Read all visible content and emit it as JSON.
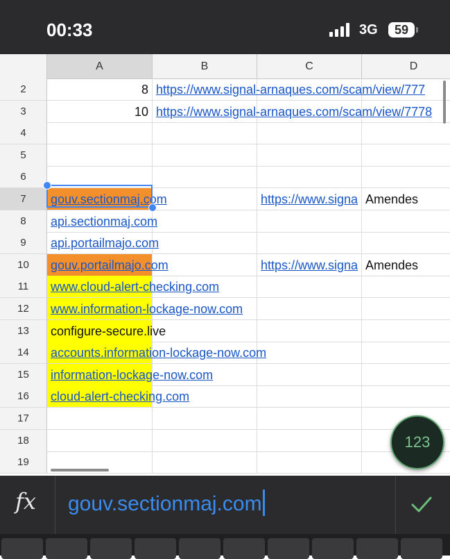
{
  "status": {
    "time": "00:33",
    "network": "3G",
    "battery": "59"
  },
  "columns": [
    "A",
    "B",
    "C",
    "D"
  ],
  "rows": [
    {
      "num": "2",
      "a": "8",
      "b": "https://www.signal-arnaques.com/scam/view/777",
      "c": "",
      "d": ""
    },
    {
      "num": "3",
      "a": "10",
      "b": "https://www.signal-arnaques.com/scam/view/7778",
      "c": "",
      "d": ""
    },
    {
      "num": "4",
      "a": "",
      "b": "",
      "c": "",
      "d": ""
    },
    {
      "num": "5",
      "a": "",
      "b": "",
      "c": "",
      "d": ""
    },
    {
      "num": "6",
      "a": "",
      "b": "",
      "c": "",
      "d": ""
    },
    {
      "num": "7",
      "a": "gouv.sectionmaj.com",
      "b": "",
      "c": "https://www.signa",
      "d": "Amendes"
    },
    {
      "num": "8",
      "a": "api.sectionmaj.com",
      "b": "",
      "c": "",
      "d": ""
    },
    {
      "num": "9",
      "a": "api.portailmajo.com",
      "b": "",
      "c": "",
      "d": ""
    },
    {
      "num": "10",
      "a": "gouv.portailmajo.com",
      "b": "",
      "c": "https://www.signa",
      "d": "Amendes"
    },
    {
      "num": "11",
      "a": "www.cloud-alert-checking.com",
      "b": "",
      "c": "",
      "d": ""
    },
    {
      "num": "12",
      "a": "www.information-lockage-now.com",
      "b": "",
      "c": "",
      "d": ""
    },
    {
      "num": "13",
      "a": "configure-secure.live",
      "b": "",
      "c": "",
      "d": ""
    },
    {
      "num": "14",
      "a": "accounts.information-lockage-now.com",
      "b": "",
      "c": "",
      "d": ""
    },
    {
      "num": "15",
      "a": "information-lockage-now.com",
      "b": "",
      "c": "",
      "d": ""
    },
    {
      "num": "16",
      "a": "cloud-alert-checking.com",
      "b": "",
      "c": "",
      "d": ""
    },
    {
      "num": "17",
      "a": "",
      "b": "",
      "c": "",
      "d": ""
    },
    {
      "num": "18",
      "a": "",
      "b": "",
      "c": "",
      "d": ""
    },
    {
      "num": "19",
      "a": "",
      "b": "",
      "c": "",
      "d": ""
    }
  ],
  "fab_label": "123",
  "formula": {
    "fx_label": "fx",
    "value": "gouv.sectionmaj.com"
  },
  "colors": {
    "orange": "#f4902c",
    "yellow": "#ffff00",
    "link": "#1a57c7",
    "selection": "#4285f4"
  }
}
